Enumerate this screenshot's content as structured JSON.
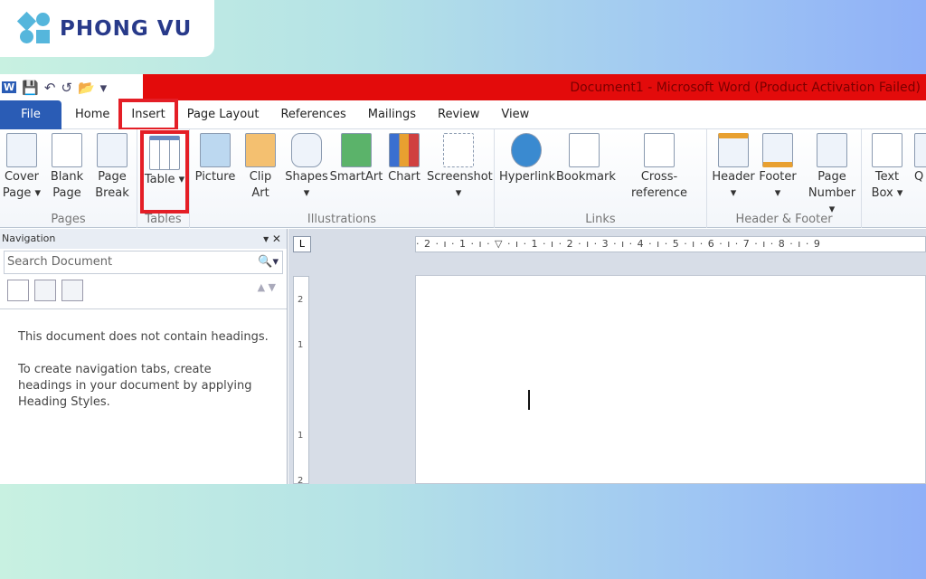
{
  "watermark": {
    "brand": "PHONG VU"
  },
  "window": {
    "title": "Document1  -  Microsoft Word (Product Activation Failed)",
    "accent": "#e30b0b",
    "highlight": "#e41e26"
  },
  "quick_access": {
    "word": "W",
    "save": "💾",
    "undo": "↶",
    "redo": "↺",
    "open": "📂",
    "customize": "▾"
  },
  "tabs": [
    "File",
    "Home",
    "Insert",
    "Page Layout",
    "References",
    "Mailings",
    "Review",
    "View"
  ],
  "active_tab": "Insert",
  "ribbon": {
    "groups": [
      {
        "label": "Pages",
        "buttons": [
          "Cover Page ▾",
          "Blank Page",
          "Page Break"
        ]
      },
      {
        "label": "Tables",
        "buttons": [
          "Table ▾"
        ]
      },
      {
        "label": "Illustrations",
        "buttons": [
          "Picture",
          "Clip Art",
          "Shapes ▾",
          "SmartArt",
          "Chart",
          "Screenshot ▾"
        ]
      },
      {
        "label": "Links",
        "buttons": [
          "Hyperlink",
          "Bookmark",
          "Cross-reference"
        ]
      },
      {
        "label": "Header & Footer",
        "buttons": [
          "Header ▾",
          "Footer ▾",
          "Page Number ▾"
        ]
      },
      {
        "label": "",
        "buttons": [
          "Text Box ▾",
          "Q Pa"
        ]
      }
    ]
  },
  "navigation": {
    "title": "Navigation",
    "search_placeholder": "Search Document",
    "message1": "This document does not contain headings.",
    "message2": "To create navigation tabs, create headings in your document by applying Heading Styles."
  },
  "ruler": {
    "corner": "L",
    "horizontal": "· 2 · ı · 1 · ı · ▽ · ı · 1 · ı · 2 · ı · 3 · ı · 4 · ı · 5 · ı · 6 · ı · 7 · ı · 8 · ı · 9",
    "vertical": [
      "2",
      "1",
      "1",
      "2"
    ]
  }
}
